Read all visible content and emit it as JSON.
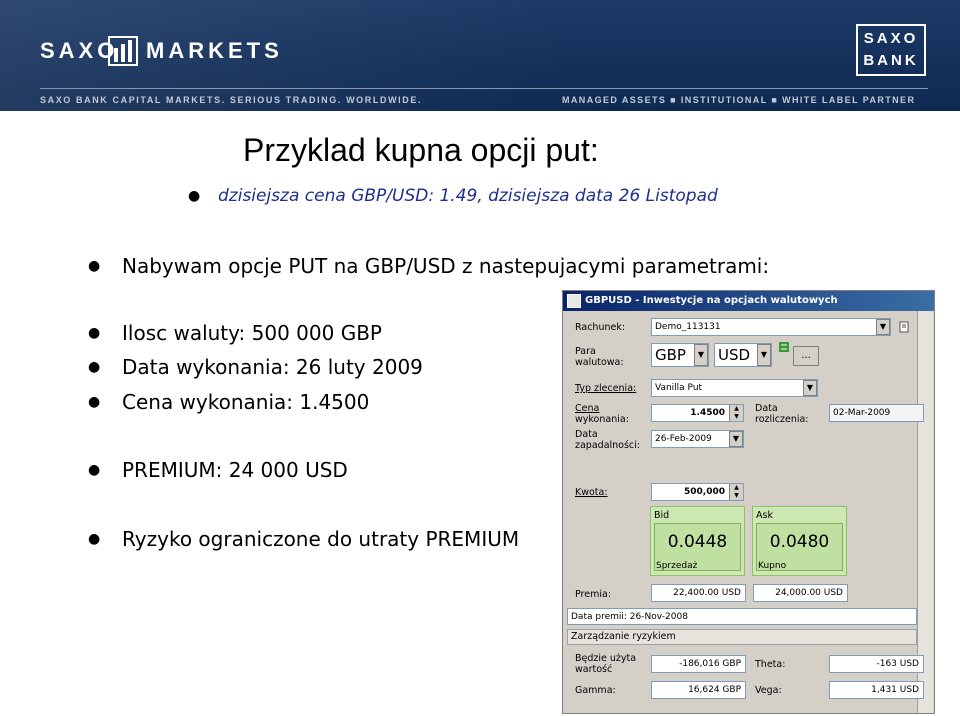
{
  "banner": {
    "logo_left": "SAXO",
    "logo_right": "MARKETS",
    "bank_line1": "SAXO",
    "bank_line2": "BANK",
    "tagline": "SAXO BANK CAPITAL MARKETS. SERIOUS TRADING. WORLDWIDE.",
    "nav": "MANAGED ASSETS  ■  INSTITUTIONAL  ■  WHITE LABEL PARTNER"
  },
  "slide": {
    "title": "Przyklad kupna opcji put:",
    "subtitle_bullet": "dzisiejsza cena GBP/USD: 1.49, dzisiejsza data 26 Listopad",
    "bullets": [
      "Nabywam opcje PUT na GBP/USD z nastepujacymi parametrami:",
      "Ilosc waluty: 500 000 GBP",
      "Data wykonania: 26 luty 2009",
      "Cena wykonania: 1.4500",
      "PREMIUM: 24 000 USD",
      "Ryzyko ograniczone do utraty PREMIUM"
    ]
  },
  "dialog": {
    "title": "GBPUSD - Inwestycje na opcjach walutowych",
    "account_label": "Rachunek:",
    "account_value": "Demo_113131",
    "pair_label_1": "Para",
    "pair_label_2": "walutowa:",
    "base_ccy": "GBP",
    "quote_ccy": "USD",
    "ellipsis_button": "...",
    "order_type_label": "Typ zlecenia:",
    "order_type_value": "Vanilla Put",
    "strike_label_1": "Cena",
    "strike_label_2": "wykonania:",
    "strike_value": "1.4500",
    "settle_label_1": "Data",
    "settle_label_2": "rozliczenia:",
    "settle_value": "02-Mar-2009",
    "expiry_label_1": "Data",
    "expiry_label_2": "zapadalności:",
    "expiry_value": "26-Feb-2009",
    "amount_label": "Kwota:",
    "amount_value": "500,000",
    "bid_header": "Bid",
    "bid_value": "0.0448",
    "bid_footer": "Sprzedaż",
    "ask_header": "Ask",
    "ask_value": "0.0480",
    "ask_footer": "Kupno",
    "premium_label": "Premia:",
    "premium_bid": "22,400.00 USD",
    "premium_ask": "24,000.00 USD",
    "premium_date": "Data premii: 26-Nov-2008",
    "risk_section": "Zarządzanie ryzykiem",
    "value_label_1": "Będzie użyta",
    "value_label_2": "wartość",
    "value_value": "-186,016 GBP",
    "theta_label": "Theta:",
    "theta_value": "-163 USD",
    "gamma_label": "Gamma:",
    "gamma_value": "16,624 GBP",
    "vega_label": "Vega:",
    "vega_value": "1,431 USD"
  }
}
